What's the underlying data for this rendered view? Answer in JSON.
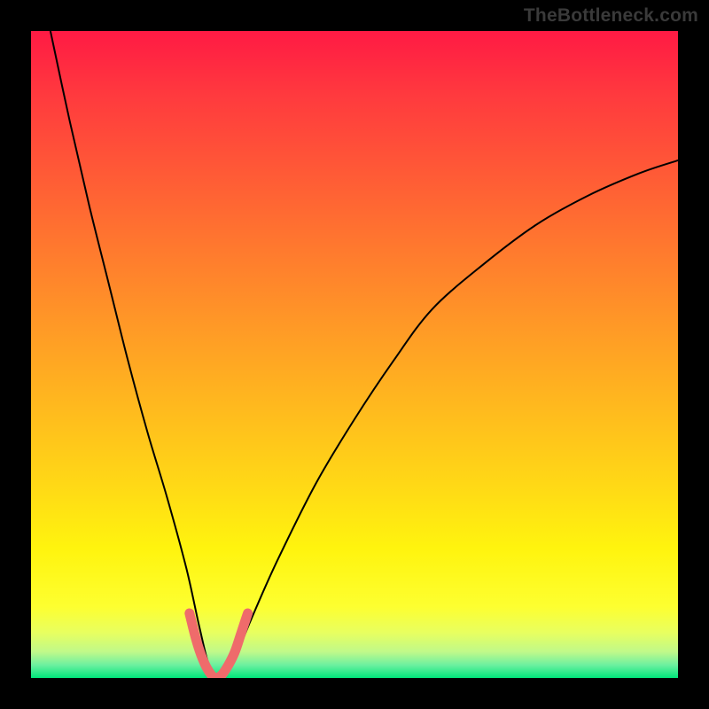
{
  "watermark": "TheBottleneck.com",
  "colors": {
    "frame": "#000000",
    "curve_black": "#000000",
    "curve_pink": "#ef6b6b",
    "gradient_top": "#ff1a44",
    "gradient_bottom": "#00e67a"
  },
  "chart_data": {
    "type": "line",
    "title": "",
    "xlabel": "",
    "ylabel": "",
    "xlim": [
      0,
      100
    ],
    "ylim": [
      0,
      100
    ],
    "grid": false,
    "legend": false,
    "notes": "No axes or tick labels are shown. Values are estimated from pixel positions. Y increases upward; 0 at the visible green floor band, 100 at the top edge of the gradient area. X spans the gradient area left→right.",
    "series": [
      {
        "name": "black-curve",
        "color": "#000000",
        "x": [
          3,
          6,
          9,
          12,
          15,
          18,
          21,
          24,
          26,
          27.5,
          29,
          31,
          34,
          38,
          44,
          50,
          56,
          62,
          70,
          78,
          86,
          94,
          100
        ],
        "y": [
          100,
          86,
          73,
          61,
          49,
          38,
          28,
          17,
          8,
          2,
          0,
          2,
          9,
          18,
          30,
          40,
          49,
          57,
          64,
          70,
          74.5,
          78,
          80
        ]
      },
      {
        "name": "pink-highlight",
        "color": "#ef6b6b",
        "x": [
          24.5,
          25.5,
          26.5,
          27.5,
          28.5,
          29.5,
          30.5,
          31.5,
          32.5,
          33.5
        ],
        "y": [
          10,
          6,
          3,
          1,
          0,
          0.5,
          2,
          4,
          7,
          10
        ]
      }
    ]
  }
}
